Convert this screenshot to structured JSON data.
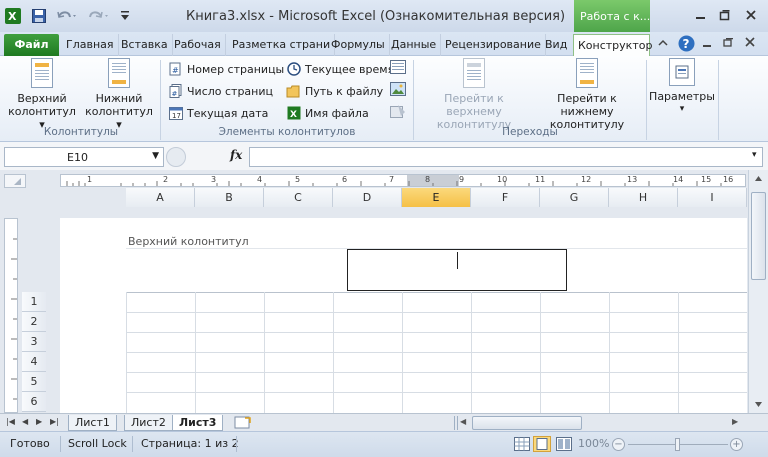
{
  "window": {
    "title": "Книга3.xlsx  -  Microsoft Excel (Ознакомительная версия)",
    "context_tab_title": "Работа с к..."
  },
  "tabs": [
    {
      "label": "Файл"
    },
    {
      "label": "Главная"
    },
    {
      "label": "Вставка"
    },
    {
      "label": "Рабочая"
    },
    {
      "label": "Разметка страни"
    },
    {
      "label": "Формулы"
    },
    {
      "label": "Данные"
    },
    {
      "label": "Рецензирование"
    },
    {
      "label": "Вид"
    },
    {
      "label": "Конструктор"
    }
  ],
  "ribbon": {
    "groups": {
      "headers": {
        "label": "Колонтитулы",
        "upper_line1": "Верхний",
        "upper_line2": "колонтитул",
        "lower_line1": "Нижний",
        "lower_line2": "колонтитул"
      },
      "elements": {
        "label": "Элементы колонтитулов",
        "page_number": "Номер страницы",
        "page_count": "Число страниц",
        "current_date": "Текущая дата",
        "current_time": "Текущее время",
        "file_path": "Путь к файлу",
        "file_name": "Имя файла"
      },
      "navigation": {
        "label": "Переходы",
        "go_upper_line1": "Перейти к верхнему",
        "go_upper_line2": "колонтитулу",
        "go_lower_line1": "Перейти к нижнему",
        "go_lower_line2": "колонтитулу"
      },
      "options": {
        "label": "Параметры"
      }
    }
  },
  "formula_bar": {
    "name_box": "E10",
    "fx": "fx",
    "formula": ""
  },
  "ruler_numbers": [
    "1",
    "1",
    "2",
    "3",
    "4",
    "5",
    "6",
    "7",
    "8",
    "9",
    "10",
    "11",
    "12",
    "13",
    "14",
    "15",
    "16"
  ],
  "columns": [
    "A",
    "B",
    "C",
    "D",
    "E",
    "F",
    "G",
    "H",
    "I"
  ],
  "rows": [
    "1",
    "2",
    "3",
    "4",
    "5",
    "6"
  ],
  "header_area": {
    "label": "Верхний колонтитул"
  },
  "sheets": [
    {
      "name": "Лист1"
    },
    {
      "name": "Лист2"
    },
    {
      "name": "Лист3",
      "active": true
    }
  ],
  "status": {
    "ready": "Готово",
    "scroll_lock": "Scroll Lock",
    "page": "Страница: 1 из 2",
    "zoom": "100%"
  },
  "colors": {
    "file_tab": "#2a8a2c",
    "context_tab": "#5cb357",
    "selected_column": "#f7c650"
  }
}
